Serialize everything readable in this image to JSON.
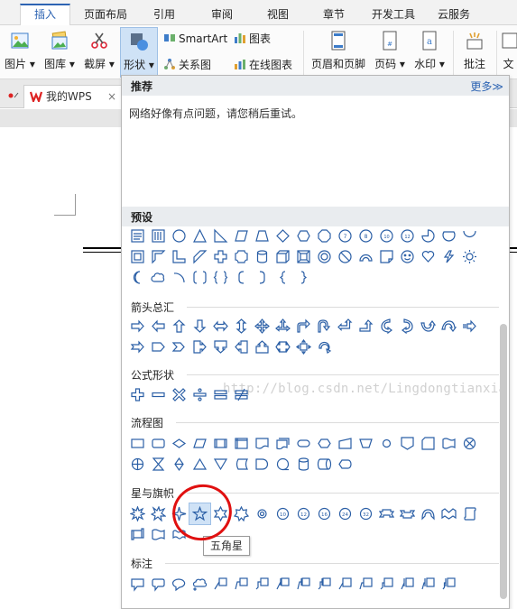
{
  "tabs": [
    {
      "label": "插入",
      "active": true
    },
    {
      "label": "页面布局"
    },
    {
      "label": "引用"
    },
    {
      "label": "审阅"
    },
    {
      "label": "视图"
    },
    {
      "label": "章节"
    },
    {
      "label": "开发工具"
    },
    {
      "label": "云服务"
    }
  ],
  "ribbon": {
    "picture": "图片",
    "gallery": "图库",
    "screenshot": "截屏",
    "shapes": "形状",
    "smartart": "SmartArt",
    "chart": "图表",
    "relation": "关系图",
    "online_chart": "在线图表",
    "header_footer": "页眉和页脚",
    "page_number": "页码",
    "watermark": "水印",
    "comment": "批注",
    "text_cut": "文"
  },
  "doc_tab": {
    "label": "我的WPS",
    "close": "×"
  },
  "panel": {
    "recommend_title": "推荐",
    "more_link": "更多≫",
    "network_error": "网络好像有点问题，请您稍后重试。",
    "preset_title": "预设",
    "sections": {
      "arrows": "箭头总汇",
      "formula": "公式形状",
      "flowchart": "流程图",
      "stars": "星与旗帜",
      "callouts": "标注"
    },
    "tooltip": "五角星"
  },
  "watermark_text": "http://blog.csdn.net/Lingdongtianxia",
  "colors": {
    "accent": "#2d64b3",
    "shape_stroke": "#2b5fa6",
    "highlight_circle": "#e01010"
  },
  "icons": {
    "shape_cells": "outline shape glyphs"
  }
}
